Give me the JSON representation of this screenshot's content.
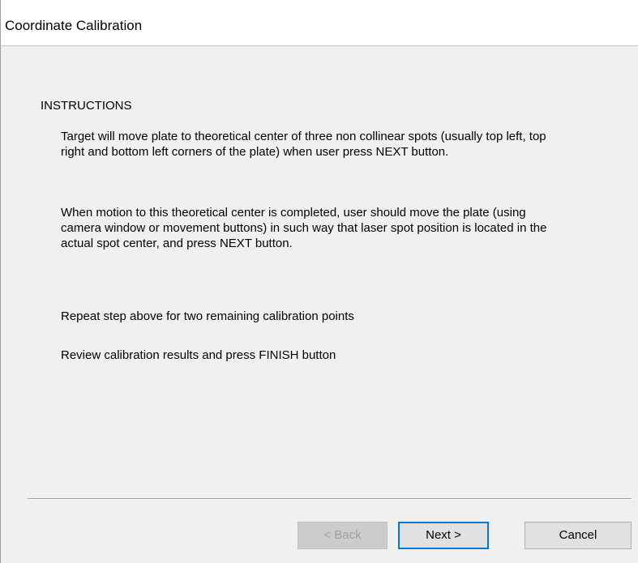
{
  "window": {
    "title": "Coordinate Calibration"
  },
  "instructions": {
    "heading": "INSTRUCTIONS",
    "paragraphs": [
      "Target will move plate to theoretical center of three non collinear spots (usually top left, top right and bottom left corners of the plate) when user press NEXT button.",
      "When motion to this theoretical center is completed, user should move the plate (using camera window or movement buttons) in such way that laser spot position is located in the actual spot center, and press NEXT button.",
      "Repeat step above for two remaining calibration points",
      "Review calibration results and press FINISH button"
    ]
  },
  "buttons": {
    "back_label": "< Back",
    "back_enabled": false,
    "next_label": "Next >",
    "cancel_label": "Cancel"
  },
  "colors": {
    "dialog_background": "#f0f0f0",
    "title_background": "#ffffff",
    "focus_border": "#0078d7",
    "disabled_text": "#a0a0a0"
  }
}
